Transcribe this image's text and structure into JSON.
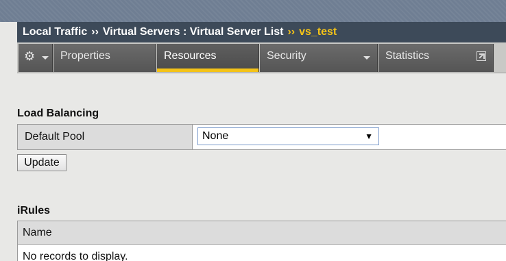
{
  "breadcrumb": {
    "items": [
      "Local Traffic",
      "Virtual Servers : Virtual Server List"
    ],
    "separator": "››",
    "current": "vs_test"
  },
  "tabs": {
    "gear_icon": "gear-icon",
    "items": [
      {
        "label": "Properties",
        "active": false
      },
      {
        "label": "Resources",
        "active": true
      },
      {
        "label": "Security",
        "active": false,
        "has_dropdown": true
      },
      {
        "label": "Statistics",
        "active": false,
        "icon": "popout-icon"
      }
    ]
  },
  "load_balancing": {
    "title": "Load Balancing",
    "default_pool_label": "Default Pool",
    "default_pool_value": "None",
    "update_label": "Update"
  },
  "irules": {
    "title": "iRules",
    "column_name": "Name",
    "empty_text": "No records to display."
  },
  "colors": {
    "header_bar": "#3d4a59",
    "accent": "#f4c318",
    "tab_bg": "#5f5f5f",
    "page_bg": "#e8e8e6"
  }
}
